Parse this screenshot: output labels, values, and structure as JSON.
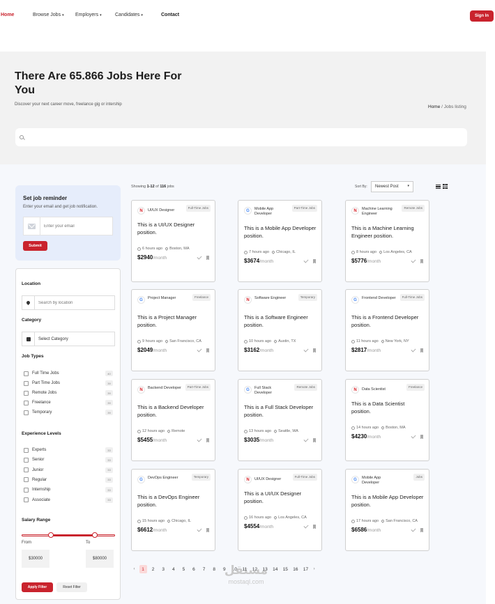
{
  "nav": {
    "home": "Home",
    "browse_jobs": "Browse Jobs",
    "employers": "Employers",
    "candidates": "Candidates",
    "contact": "Contact",
    "caret": "▾",
    "sign_in": "Sign In"
  },
  "hero": {
    "title": "There Are 65.866 Jobs Here For You",
    "subtitle": "Discover your next career move, freelance gig or intership",
    "breadcrumb_home": "Home",
    "breadcrumb_current": " / Jobs listing",
    "search_placeholder": ""
  },
  "reminder": {
    "title": "Set job reminder",
    "subtitle": "Enter your email and get job notification.",
    "email_placeholder": "Enter your email",
    "submit": "Submit"
  },
  "filters": {
    "location_label": "Location",
    "location_placeholder": "Search by location",
    "category_label": "Category",
    "category_value": "Select Category",
    "job_types_label": "Job Types",
    "job_types": [
      {
        "label": "Full Time Jobs",
        "count": "40"
      },
      {
        "label": "Part Time Jobs",
        "count": "39"
      },
      {
        "label": "Remote Jobs",
        "count": "39"
      },
      {
        "label": "Freelance",
        "count": "39"
      },
      {
        "label": "Temporary",
        "count": "39"
      }
    ],
    "experience_label": "Experience Levels",
    "experience": [
      {
        "label": "Experts",
        "count": "33"
      },
      {
        "label": "Senior",
        "count": "33"
      },
      {
        "label": "Junior",
        "count": "33"
      },
      {
        "label": "Regular",
        "count": "33"
      },
      {
        "label": "Internship",
        "count": "33"
      },
      {
        "label": "Associate",
        "count": "33"
      }
    ],
    "salary_label": "Salary Range",
    "salary_range_fraction": [
      0.31,
      0.78
    ],
    "from_label": "From",
    "to_label": "To",
    "from_value": "$30000",
    "to_value": "$80000",
    "apply": "Apply Filter",
    "reset": "Reset Filter"
  },
  "listing": {
    "showing_prefix": "Showing ",
    "showing_range": "1-12",
    "showing_mid": " of ",
    "showing_total": "116",
    "showing_suffix": " jobs",
    "sort_label": "Sort By:",
    "sort_value": "Newest Post",
    "per_month": "/month"
  },
  "jobs": [
    {
      "logo": "netflix",
      "title": "UI/UX Designer",
      "badge": "Full-Time Jobs",
      "desc": "This is a UI/UX Designer position.",
      "time": "6 hours ago",
      "location": "Boston, MA",
      "salary": "$2940"
    },
    {
      "logo": "google",
      "title": "Mobile App Developer",
      "badge": "Part-Time Jobs",
      "desc": "This is a Mobile App Developer position.",
      "time": "7 hours ago",
      "location": "Chicago, IL",
      "salary": "$3674"
    },
    {
      "logo": "netflix",
      "title": "Machine Learning Engineer",
      "badge": "Remote Jobs",
      "desc": "This is a Machine Learning Engineer position.",
      "time": "8 hours ago",
      "location": "Los Angeles, CA",
      "salary": "$5776"
    },
    {
      "logo": "google",
      "title": "Project Manager",
      "badge": "Freelance",
      "desc": "This is a Project Manager position.",
      "time": "9 hours ago",
      "location": "San Francisco, CA",
      "salary": "$2049"
    },
    {
      "logo": "netflix",
      "title": "Software Engineer",
      "badge": "Temporary",
      "desc": "This is a Software Engineer position.",
      "time": "10 hours ago",
      "location": "Austin, TX",
      "salary": "$3162"
    },
    {
      "logo": "google",
      "title": "Frontend Developer",
      "badge": "Full-Time Jobs",
      "desc": "This is a Frontend Developer position.",
      "time": "11 hours ago",
      "location": "New York, NY",
      "salary": "$2817"
    },
    {
      "logo": "netflix",
      "title": "Backend Developer",
      "badge": "Part-Time Jobs",
      "desc": "This is a Backend Developer position.",
      "time": "12 hours ago",
      "location": "Remote",
      "salary": "$5455"
    },
    {
      "logo": "google",
      "title": "Full Stack Developer",
      "badge": "Remote Jobs",
      "desc": "This is a Full Stack Developer position.",
      "time": "13 hours ago",
      "location": "Seattle, WA",
      "salary": "$3035"
    },
    {
      "logo": "netflix",
      "title": "Data Scientist",
      "badge": "Freelance",
      "desc": "This is a Data Scientist position.",
      "time": "14 hours ago",
      "location": "Boston, MA",
      "salary": "$4230"
    },
    {
      "logo": "google",
      "title": "DevOps Engineer",
      "badge": "Temporary",
      "desc": "This is a DevOps Engineer position.",
      "time": "15 hours ago",
      "location": "Chicago, IL",
      "salary": "$6612"
    },
    {
      "logo": "netflix",
      "title": "UI/UX Designer",
      "badge": "Full-Time Jobs",
      "desc": "This is a UI/UX Designer position.",
      "time": "16 hours ago",
      "location": "Los Angeles, CA",
      "salary": "$4554"
    },
    {
      "logo": "google",
      "title": "Mobile App Developer",
      "badge": "Jobs",
      "desc": "This is a Mobile App Developer position.",
      "time": "17 hours ago",
      "location": "San Francisco, CA",
      "salary": "$6586"
    }
  ],
  "pagination": {
    "prev": "‹",
    "next": "›",
    "active": "1",
    "pages": [
      "1",
      "2",
      "3",
      "4",
      "5",
      "6",
      "7",
      "8",
      "9",
      "10",
      "11",
      "12",
      "13",
      "14",
      "15",
      "16",
      "17"
    ]
  },
  "watermark": {
    "main": "مستقل",
    "sub": "mostaql.com"
  },
  "colors": {
    "accent": "#c9232d",
    "reminder_bg": "#e6edfb",
    "hero_bg": "#f2f2f2",
    "content_bg": "#f6f8fc"
  }
}
